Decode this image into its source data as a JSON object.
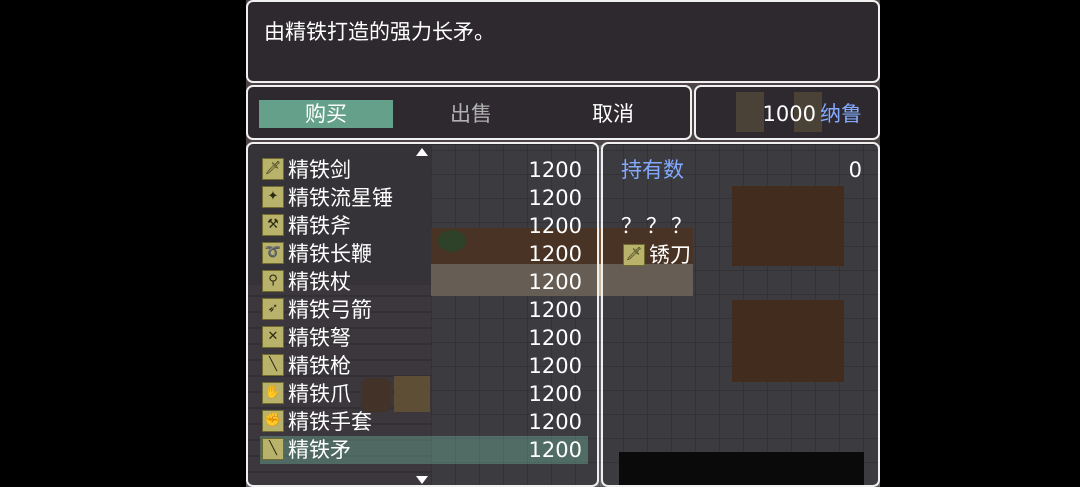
{
  "help": {
    "text": "由精铁打造的强力长矛。"
  },
  "command": {
    "buy": "购买",
    "sell": "出售",
    "cancel": "取消"
  },
  "gold": {
    "amount": "1000",
    "unit": "纳鲁"
  },
  "items": [
    {
      "name": "精铁剑",
      "price": "1200",
      "icon": "sword-icon",
      "glyph": "🗡"
    },
    {
      "name": "精铁流星锤",
      "price": "1200",
      "icon": "flail-icon",
      "glyph": "✦"
    },
    {
      "name": "精铁斧",
      "price": "1200",
      "icon": "axe-icon",
      "glyph": "⚒"
    },
    {
      "name": "精铁长鞭",
      "price": "1200",
      "icon": "whip-icon",
      "glyph": "➰"
    },
    {
      "name": "精铁杖",
      "price": "1200",
      "icon": "staff-icon",
      "glyph": "⚲"
    },
    {
      "name": "精铁弓箭",
      "price": "1200",
      "icon": "bow-icon",
      "glyph": "➶"
    },
    {
      "name": "精铁弩",
      "price": "1200",
      "icon": "crossbow-icon",
      "glyph": "✕"
    },
    {
      "name": "精铁枪",
      "price": "1200",
      "icon": "gun-icon",
      "glyph": "╲"
    },
    {
      "name": "精铁爪",
      "price": "1200",
      "icon": "claw-icon",
      "glyph": "✋"
    },
    {
      "name": "精铁手套",
      "price": "1200",
      "icon": "glove-icon",
      "glyph": "✊"
    },
    {
      "name": "精铁矛",
      "price": "1200",
      "icon": "spear-icon",
      "glyph": "╲"
    }
  ],
  "status": {
    "owned_label": "持有数",
    "owned_value": "0",
    "unknown": "？？？",
    "equipped_name": "锈刀",
    "equipped_icon": "rusty-blade-icon",
    "equipped_glyph": "🗡"
  },
  "colors": {
    "selection": "#78c8aa",
    "system_blue": "#84aaff",
    "border": "#f0f0f0"
  }
}
